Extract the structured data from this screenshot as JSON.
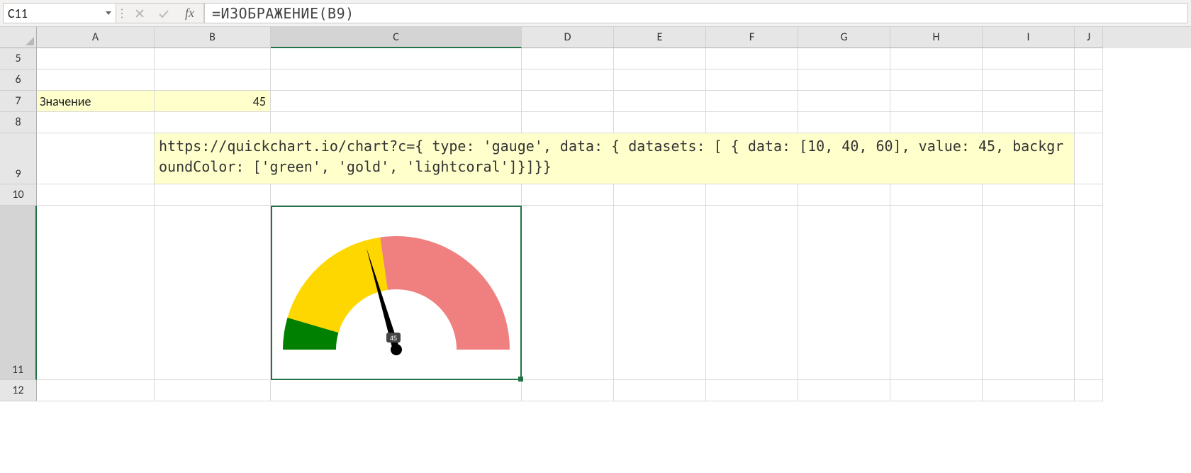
{
  "formula_bar": {
    "name_box": "C11",
    "fx_label": "fx",
    "formula": "=ИЗОБРАЖЕНИЕ(B9)"
  },
  "columns": {
    "A": "A",
    "B": "B",
    "C": "C",
    "D": "D",
    "E": "E",
    "F": "F",
    "G": "G",
    "H": "H",
    "I": "I",
    "J": "J"
  },
  "rows": {
    "r5": "5",
    "r6": "6",
    "r7": "7",
    "r8": "8",
    "r9": "9",
    "r10": "10",
    "r11": "11",
    "r12": "12"
  },
  "cells": {
    "A7": "Значение",
    "B7": "45",
    "B9": "https://quickchart.io/chart?c={ type: 'gauge', data: { datasets: [ { data: [10, 40, 60], value: 45, backgroundColor: ['green', 'gold', 'lightcoral']}]}}"
  },
  "chart_data": {
    "type": "gauge",
    "segments": [
      10,
      40,
      60
    ],
    "value": 45,
    "value_label": "45",
    "colors": [
      "green",
      "gold",
      "lightcoral"
    ],
    "range": [
      0,
      110
    ]
  },
  "colors": {
    "highlight": "#ffffcc",
    "excel_green": "#217346"
  }
}
